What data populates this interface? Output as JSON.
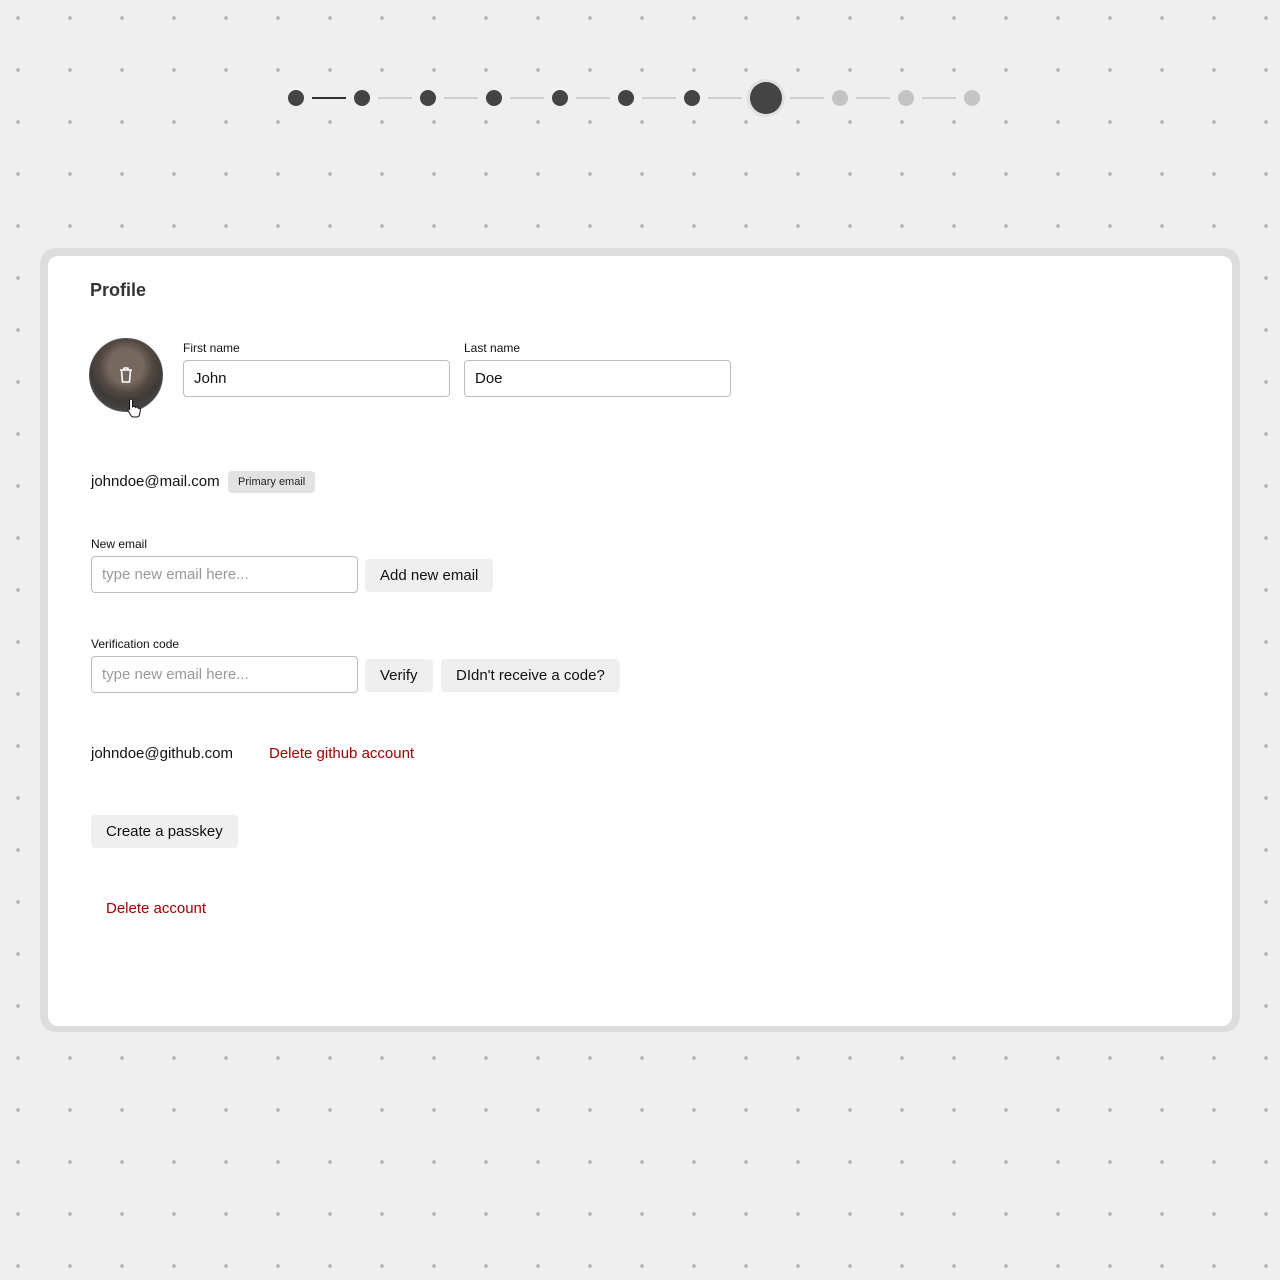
{
  "stepper": {
    "total_steps": 11,
    "current_step": 8,
    "colors": {
      "done": "#444444",
      "pending": "#c4c4c4"
    }
  },
  "profile": {
    "title": "Profile",
    "first_name": {
      "label": "First name",
      "value": "John"
    },
    "last_name": {
      "label": "Last name",
      "value": "Doe"
    },
    "primary_email": "johndoe@mail.com",
    "primary_badge": "Primary email",
    "new_email": {
      "label": "New email",
      "placeholder": "type new email here..."
    },
    "add_email_button": "Add new email",
    "verification": {
      "label": "Verification code",
      "placeholder": "type new email here..."
    },
    "verify_button": "Verify",
    "resend_button": "DIdn't receive a code?",
    "github_email": "johndoe@github.com",
    "delete_github": "Delete github account",
    "create_passkey": "Create a passkey",
    "delete_account": "Delete account",
    "danger_color": "#a00000"
  }
}
